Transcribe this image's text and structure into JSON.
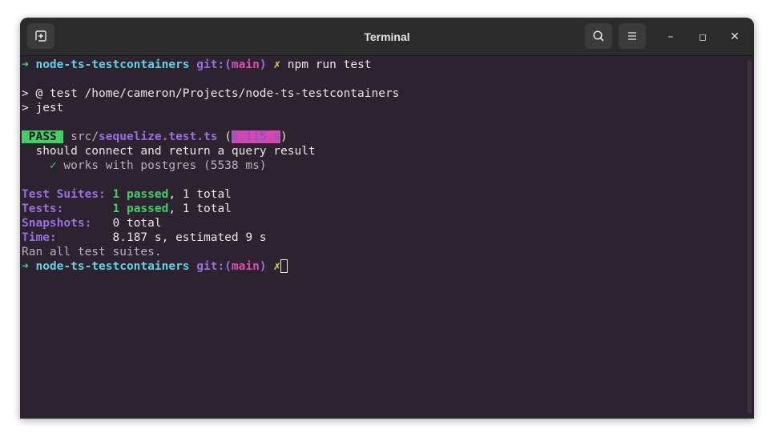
{
  "window": {
    "title": "Terminal",
    "icons": {
      "new_tab": "new-tab-icon",
      "search": "search-icon",
      "menu": "hamburger-menu-icon",
      "minimize": "minimize-icon",
      "maximize": "maximize-icon",
      "close": "close-icon"
    },
    "controls": {
      "minimize": "–",
      "maximize": "◻",
      "close": "✕"
    }
  },
  "prompt": {
    "arrow": "➜",
    "directory": "node-ts-testcontainers",
    "git_label": "git:(",
    "branch": "main",
    "git_close": ")",
    "dirty_mark": "✗"
  },
  "command": "npm run test",
  "output": {
    "script_line": "> @ test /home/cameron/Projects/node-ts-testcontainers",
    "jest_line": "> jest",
    "pass_badge": " PASS ",
    "file_prefix": "src/",
    "file_name": "sequelize.test.ts",
    "duration_open": "(",
    "duration": "8.115 s",
    "duration_close": ")",
    "describe": "should connect and return a query result",
    "check_mark": "✓",
    "test_name": "works with postgres (5538 ms)",
    "summary": {
      "suites_label": "Test Suites:",
      "suites_passed": "1 passed",
      "suites_total": ", 1 total",
      "tests_label": "Tests:",
      "tests_passed": "1 passed",
      "tests_total": ", 1 total",
      "snapshots_label": "Snapshots:",
      "snapshots_value": "0 total",
      "time_label": "Time:",
      "time_value": "8.187 s, estimated 9 s",
      "ran_all": "Ran all test suites."
    }
  },
  "colors": {
    "terminal_bg": "#2c2230",
    "titlebar_bg": "#2b2b2b",
    "green": "#3fd168",
    "cyan": "#5fd3e6",
    "purple": "#9a6fe0",
    "magenta": "#e04db7",
    "yellow": "#e8d84b"
  }
}
